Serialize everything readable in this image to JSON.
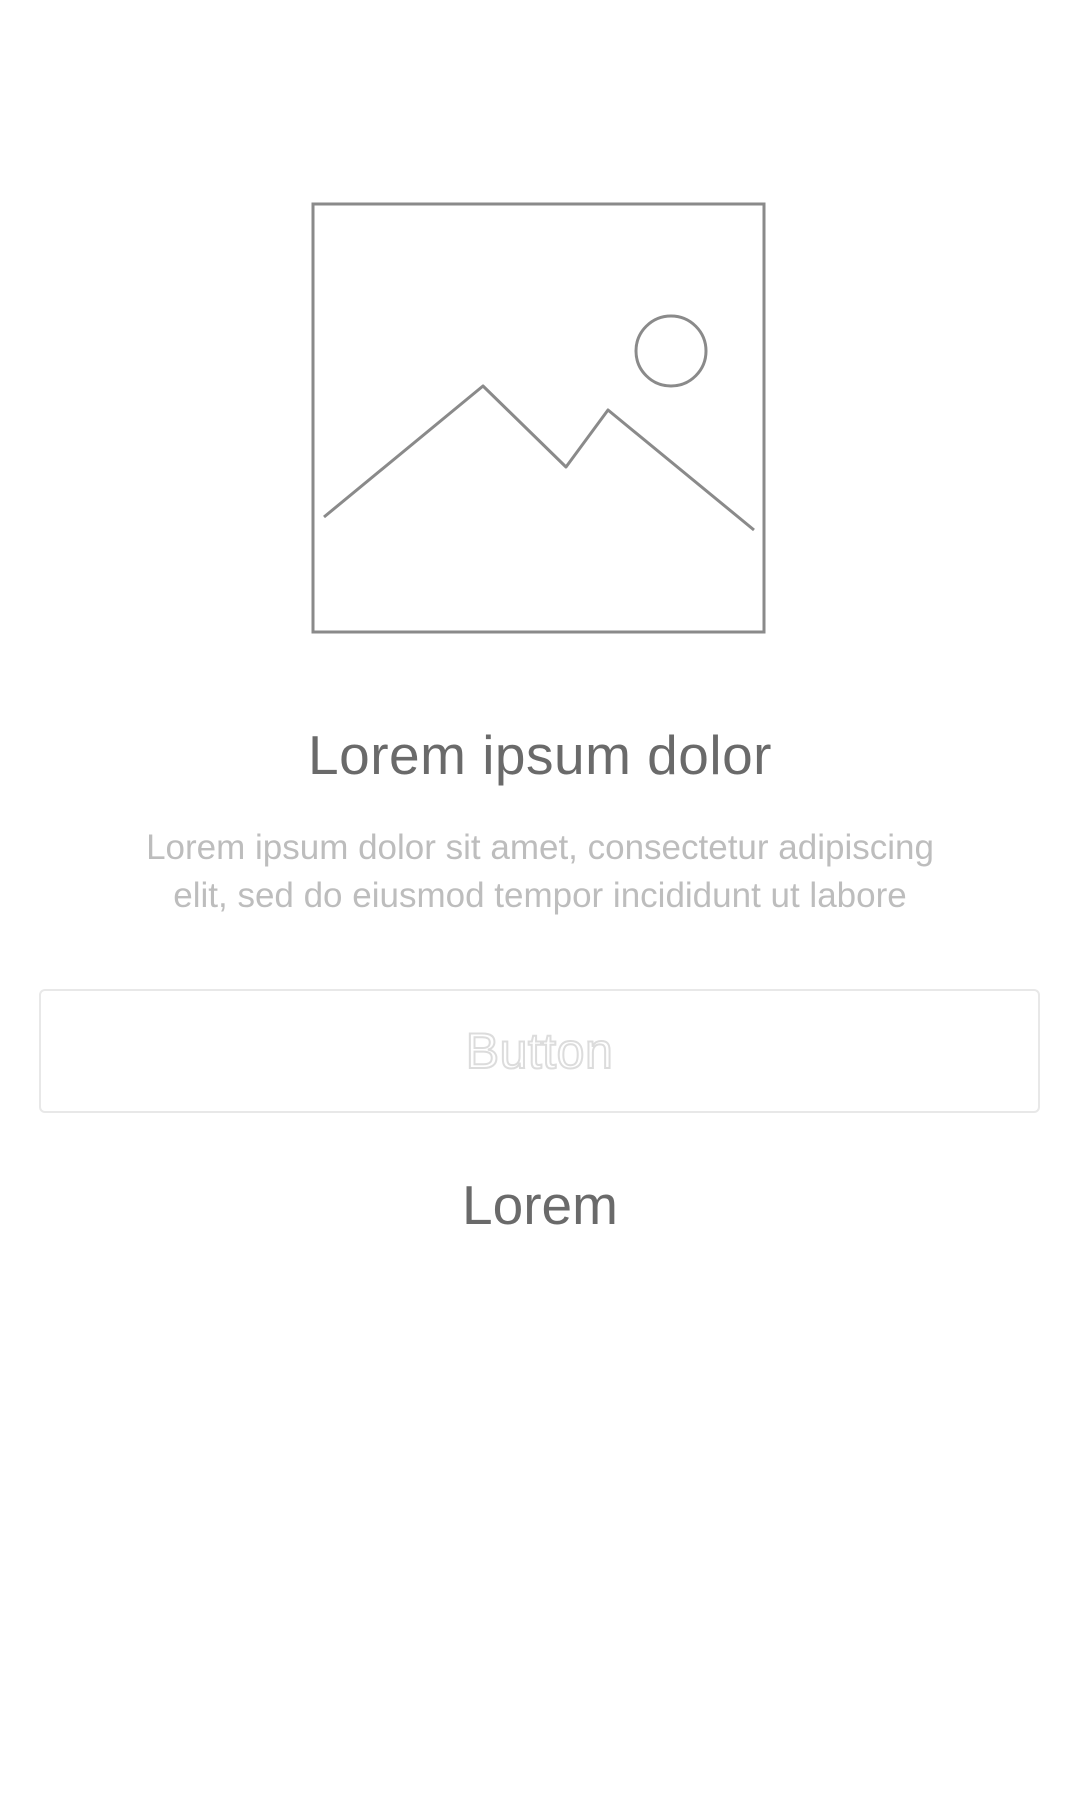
{
  "content": {
    "image_icon": "image-placeholder-icon",
    "title": "Lorem ipsum dolor",
    "description_line1": "Lorem ipsum dolor sit amet, consectetur adipiscing",
    "description_line2": "elit, sed do eiusmod tempor incididunt ut labore",
    "button_label": "Button",
    "link_label": "Lorem"
  },
  "colors": {
    "background": "#ffffff",
    "title_text": "#6a6a6a",
    "description_text": "#bdbdbd",
    "placeholder_stroke": "#8a8a8a",
    "button_border": "#e8e8e8"
  }
}
